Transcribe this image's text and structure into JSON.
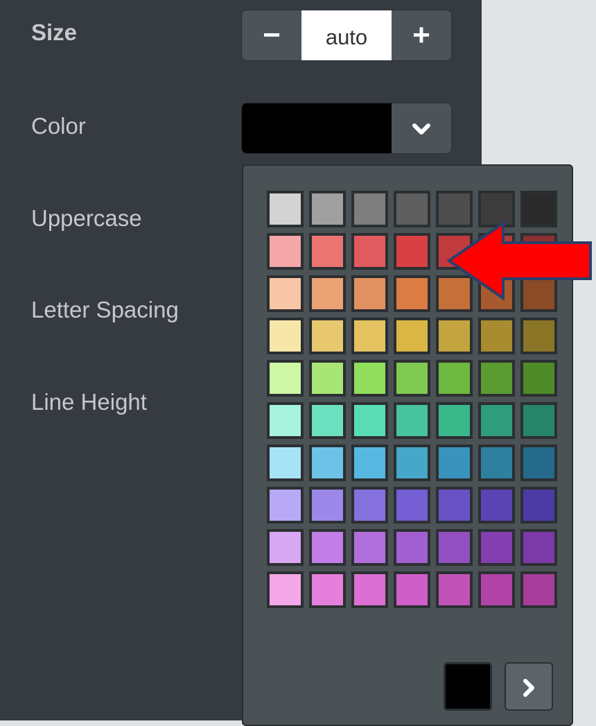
{
  "labels": {
    "size": "Size",
    "color": "Color",
    "uppercase": "Uppercase",
    "letter_spacing": "Letter Spacing",
    "line_height": "Line Height"
  },
  "size_control": {
    "minus": "−",
    "value": "auto",
    "plus": "+"
  },
  "color_control": {
    "current_color": "#000000",
    "dropdown_icon": "chevron-down-icon"
  },
  "palette": [
    [
      "#d3d3d3",
      "#a0a0a0",
      "#7e7e7e",
      "#5e5e5e",
      "#4e4e4e",
      "#3c3c3c",
      "#2a2a2a"
    ],
    [
      "#f4a6a8",
      "#ec7574",
      "#e05b5f",
      "#d94043",
      "#c13a3e",
      "#b03a3c",
      "#8c2f31"
    ],
    [
      "#f6c6a7",
      "#eba274",
      "#e19160",
      "#dc7c45",
      "#c67039",
      "#a65a2d",
      "#8a4b26"
    ],
    [
      "#f6e7a9",
      "#e7c86f",
      "#e3c25f",
      "#dab644",
      "#c4a43f",
      "#a88c2f",
      "#8a7426"
    ],
    [
      "#cdf6a5",
      "#a9e576",
      "#91df5c",
      "#7fc952",
      "#6fb83f",
      "#5c9c33",
      "#4f8a28"
    ],
    [
      "#a7f3dd",
      "#6de0c0",
      "#5bddb3",
      "#48c49c",
      "#38b88b",
      "#2f9d79",
      "#268566"
    ],
    [
      "#a8e2f7",
      "#6dc3e7",
      "#56b8e0",
      "#46a7c9",
      "#3a93bd",
      "#2f7f9f",
      "#266a8b"
    ],
    [
      "#b8a9f6",
      "#9c88e8",
      "#8571de",
      "#755fd4",
      "#6852c3",
      "#5a44b3",
      "#4c3aa5"
    ],
    [
      "#d8a7f3",
      "#c07ee6",
      "#b06fdb",
      "#a25fd0",
      "#9350c0",
      "#833fb0",
      "#7b3aa8"
    ],
    [
      "#f4a7e9",
      "#e57fdb",
      "#dc70d2",
      "#d05ec8",
      "#c253b6",
      "#b243a6",
      "#a73c9b"
    ]
  ],
  "custom_color": "#000000",
  "more_button_icon": "chevron-right-icon",
  "annotation_arrow_color": "#ff0000"
}
